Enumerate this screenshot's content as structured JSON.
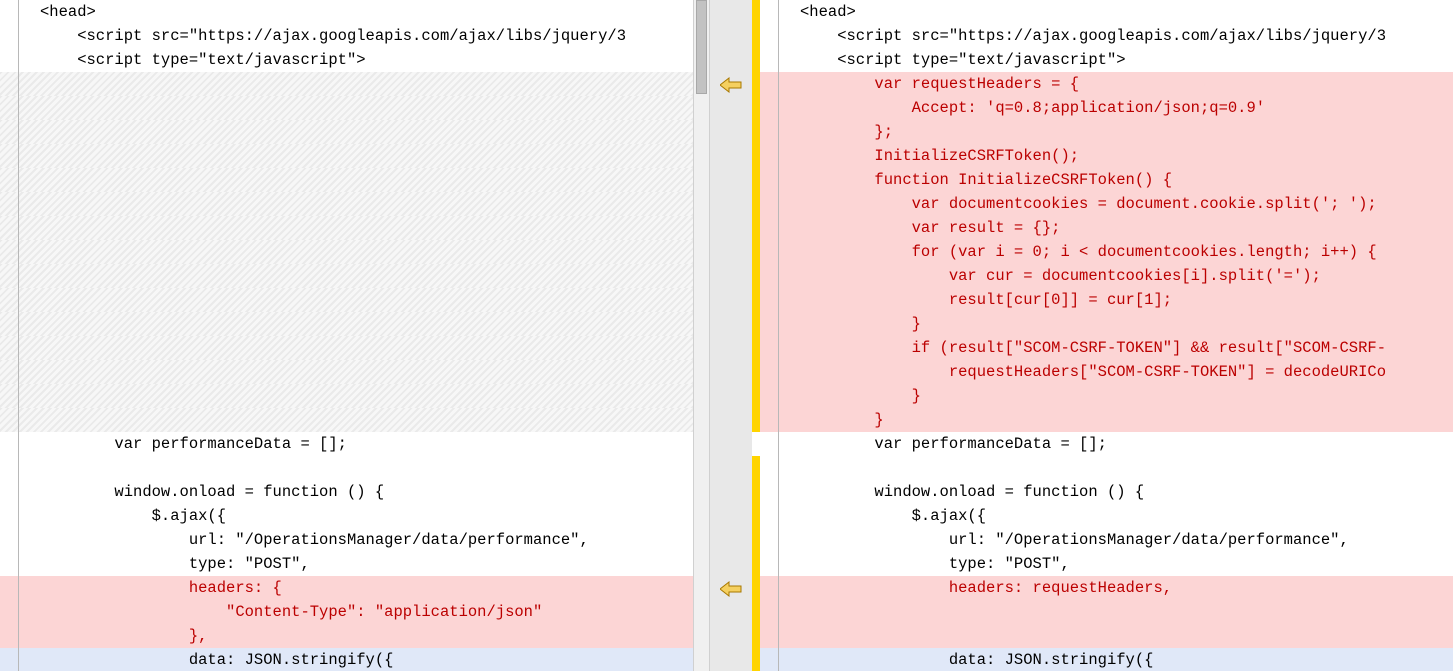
{
  "left": {
    "lines": [
      {
        "text": "<head>",
        "bg": "white",
        "txt": "black",
        "indent": 0
      },
      {
        "text": "    <script src=\"https://ajax.googleapis.com/ajax/libs/jquery/3",
        "bg": "white",
        "txt": "black",
        "indent": 0
      },
      {
        "text": "    <script type=\"text/javascript\">",
        "bg": "white",
        "txt": "black",
        "indent": 0
      },
      {
        "text": "",
        "bg": "hatch",
        "txt": "black",
        "indent": 0
      },
      {
        "text": "",
        "bg": "hatch",
        "txt": "black",
        "indent": 0
      },
      {
        "text": "",
        "bg": "hatch",
        "txt": "black",
        "indent": 0
      },
      {
        "text": "",
        "bg": "hatch",
        "txt": "black",
        "indent": 0
      },
      {
        "text": "",
        "bg": "hatch",
        "txt": "black",
        "indent": 0
      },
      {
        "text": "",
        "bg": "hatch",
        "txt": "black",
        "indent": 0
      },
      {
        "text": "",
        "bg": "hatch",
        "txt": "black",
        "indent": 0
      },
      {
        "text": "",
        "bg": "hatch",
        "txt": "black",
        "indent": 0
      },
      {
        "text": "",
        "bg": "hatch",
        "txt": "black",
        "indent": 0
      },
      {
        "text": "",
        "bg": "hatch",
        "txt": "black",
        "indent": 0
      },
      {
        "text": "",
        "bg": "hatch",
        "txt": "black",
        "indent": 0
      },
      {
        "text": "",
        "bg": "hatch",
        "txt": "black",
        "indent": 0
      },
      {
        "text": "",
        "bg": "hatch",
        "txt": "black",
        "indent": 0
      },
      {
        "text": "",
        "bg": "hatch",
        "txt": "black",
        "indent": 0
      },
      {
        "text": "",
        "bg": "hatch",
        "txt": "black",
        "indent": 0
      },
      {
        "text": "        var performanceData = [];",
        "bg": "white",
        "txt": "black",
        "indent": 0
      },
      {
        "text": "",
        "bg": "white",
        "txt": "black",
        "indent": 0
      },
      {
        "text": "        window.onload = function () {",
        "bg": "white",
        "txt": "black",
        "indent": 0
      },
      {
        "text": "            $.ajax({",
        "bg": "white",
        "txt": "black",
        "indent": 0
      },
      {
        "text": "                url: \"/OperationsManager/data/performance\",",
        "bg": "white",
        "txt": "black",
        "indent": 0
      },
      {
        "text": "                type: \"POST\",",
        "bg": "white",
        "txt": "black",
        "indent": 0
      },
      {
        "text": "                headers: {",
        "bg": "removed",
        "txt": "red",
        "indent": 0
      },
      {
        "text": "                    \"Content-Type\": \"application/json\"",
        "bg": "removed",
        "txt": "red",
        "indent": 0
      },
      {
        "text": "                },",
        "bg": "removed",
        "txt": "red",
        "indent": 0
      },
      {
        "text": "                data: JSON.stringify({",
        "bg": "blue",
        "txt": "black",
        "indent": 0
      }
    ]
  },
  "right": {
    "lines": [
      {
        "text": "<head>",
        "bg": "white",
        "txt": "black"
      },
      {
        "text": "    <script src=\"https://ajax.googleapis.com/ajax/libs/jquery/3",
        "bg": "white",
        "txt": "black"
      },
      {
        "text": "    <script type=\"text/javascript\">",
        "bg": "white",
        "txt": "black"
      },
      {
        "text": "        var requestHeaders = {",
        "bg": "added",
        "txt": "red"
      },
      {
        "text": "            Accept: 'q=0.8;application/json;q=0.9'",
        "bg": "added",
        "txt": "red"
      },
      {
        "text": "        };",
        "bg": "added",
        "txt": "red"
      },
      {
        "text": "        InitializeCSRFToken();",
        "bg": "added",
        "txt": "red"
      },
      {
        "text": "        function InitializeCSRFToken() {",
        "bg": "added",
        "txt": "red"
      },
      {
        "text": "            var documentcookies = document.cookie.split('; ');",
        "bg": "added",
        "txt": "red"
      },
      {
        "text": "            var result = {};",
        "bg": "added",
        "txt": "red"
      },
      {
        "text": "            for (var i = 0; i < documentcookies.length; i++) {",
        "bg": "added",
        "txt": "red"
      },
      {
        "text": "                var cur = documentcookies[i].split('=');",
        "bg": "added",
        "txt": "red"
      },
      {
        "text": "                result[cur[0]] = cur[1];",
        "bg": "added",
        "txt": "red"
      },
      {
        "text": "            }",
        "bg": "added",
        "txt": "red"
      },
      {
        "text": "            if (result[\"SCOM-CSRF-TOKEN\"] && result[\"SCOM-CSRF-",
        "bg": "added",
        "txt": "red"
      },
      {
        "text": "                requestHeaders[\"SCOM-CSRF-TOKEN\"] = decodeURICo",
        "bg": "added",
        "txt": "red"
      },
      {
        "text": "            }",
        "bg": "added",
        "txt": "red"
      },
      {
        "text": "        }",
        "bg": "added",
        "txt": "red"
      },
      {
        "text": "        var performanceData = [];",
        "bg": "white",
        "txt": "black"
      },
      {
        "text": "",
        "bg": "white",
        "txt": "black"
      },
      {
        "text": "        window.onload = function () {",
        "bg": "white",
        "txt": "black"
      },
      {
        "text": "            $.ajax({",
        "bg": "white",
        "txt": "black"
      },
      {
        "text": "                url: \"/OperationsManager/data/performance\",",
        "bg": "white",
        "txt": "black"
      },
      {
        "text": "                type: \"POST\",",
        "bg": "white",
        "txt": "black"
      },
      {
        "text": "                headers: requestHeaders,",
        "bg": "added",
        "txt": "red"
      },
      {
        "text": "",
        "bg": "addedpale",
        "txt": "red"
      },
      {
        "text": "",
        "bg": "addedpale",
        "txt": "red"
      },
      {
        "text": "                data: JSON.stringify({",
        "bg": "blue",
        "txt": "black"
      }
    ]
  },
  "diff_arrows": {
    "arrow1_dir": "left",
    "arrow2_dir": "left"
  }
}
